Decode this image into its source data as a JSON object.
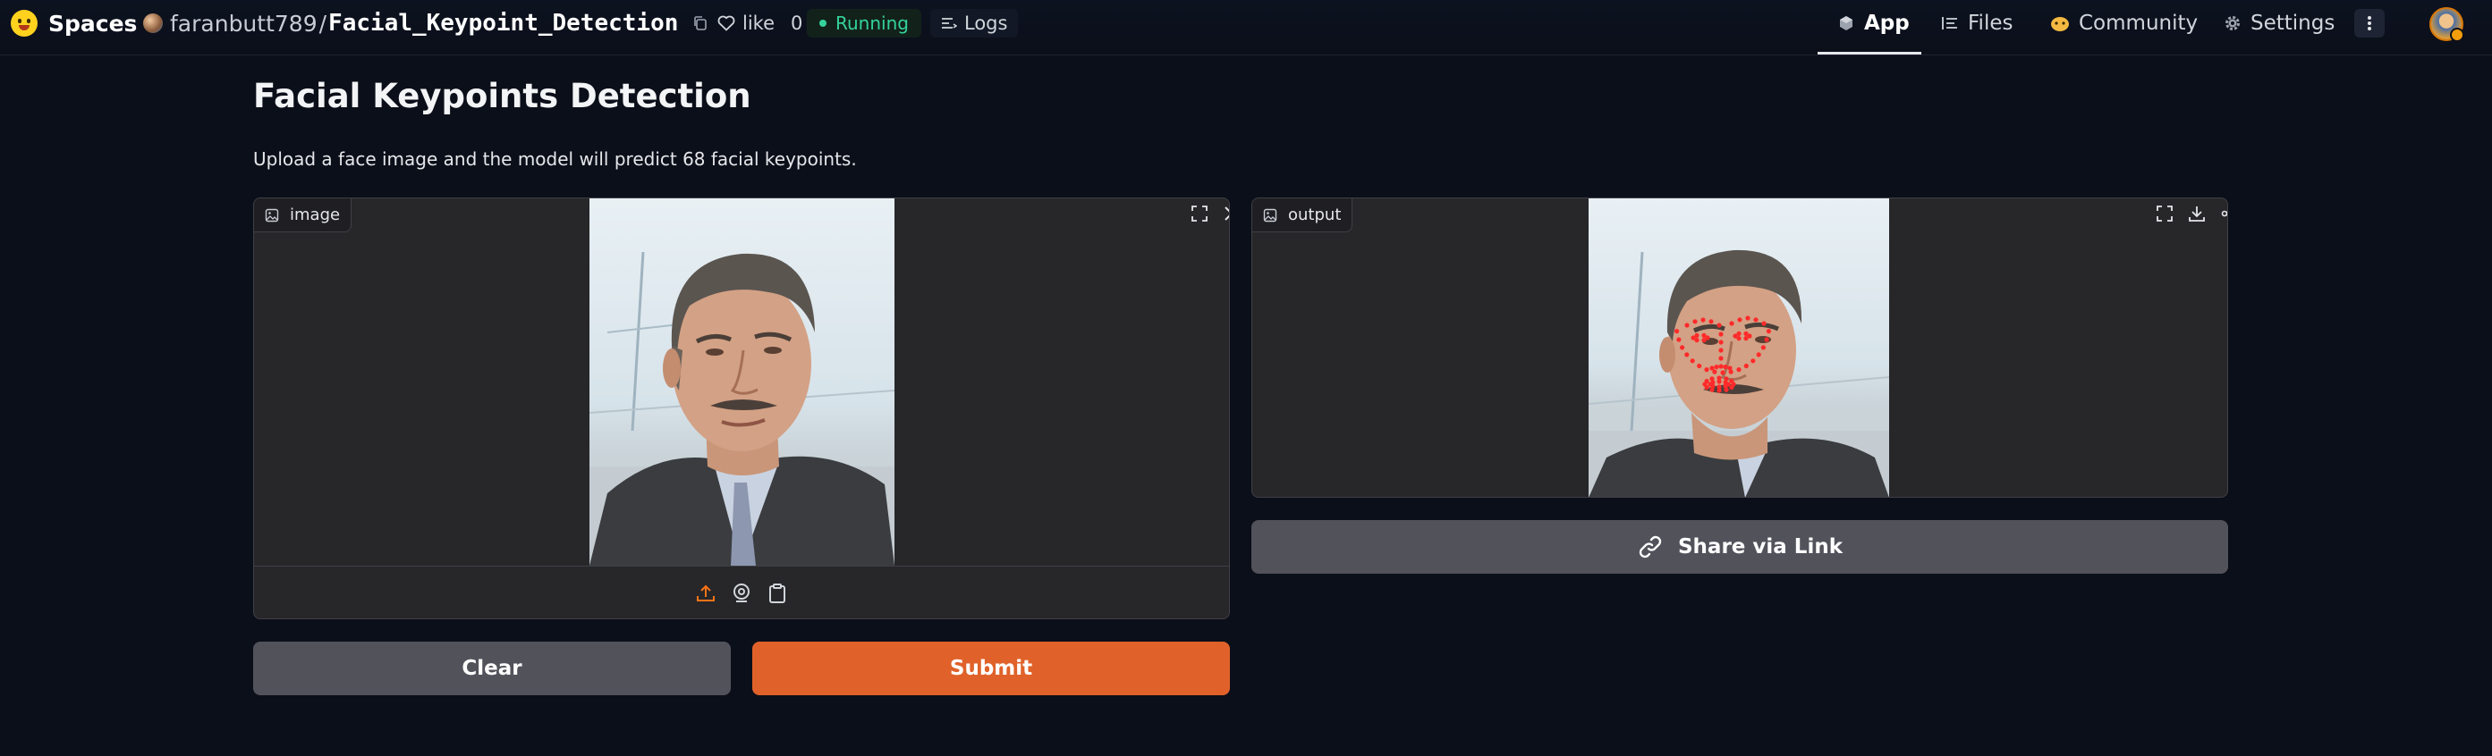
{
  "nav": {
    "brand": "Spaces",
    "owner": "faranbutt789",
    "separator": "/",
    "space_name": "Facial_Keypoint_Detection",
    "like_label": "like",
    "like_count": "0",
    "status": "Running",
    "logs_label": "Logs",
    "tabs": [
      {
        "label": "App",
        "icon": "app-cube-icon",
        "active": true
      },
      {
        "label": "Files",
        "icon": "files-icon",
        "active": false
      },
      {
        "label": "Community",
        "icon": "community-icon",
        "active": false
      },
      {
        "label": "Settings",
        "icon": "gear-icon",
        "active": false
      }
    ]
  },
  "page": {
    "title": "Facial Keypoints Detection",
    "description": "Upload a face image and the model will predict 68 facial keypoints."
  },
  "input_panel": {
    "label": "image",
    "image_content": "photo of a man in a suit with tie"
  },
  "output_panel": {
    "label": "output",
    "image_content": "face photo with 68 red keypoint markers overlaid"
  },
  "buttons": {
    "clear": "Clear",
    "submit": "Submit",
    "share": "Share via Link"
  },
  "colors": {
    "background": "#0b0f19",
    "panel": "#27272a",
    "primary_button": "#e0622a",
    "secondary_button": "#52525b",
    "status_running": "#34d399",
    "keypoint": "#ff2a2a"
  }
}
